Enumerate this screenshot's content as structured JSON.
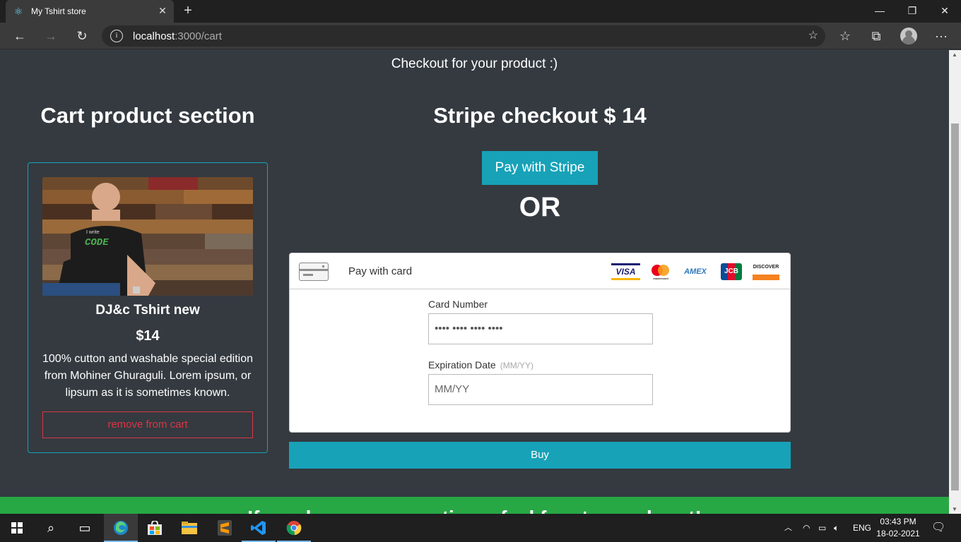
{
  "browser": {
    "tab_title": "My Tshirt store",
    "tab_close": "✕",
    "new_tab": "+",
    "url_host": "localhost",
    "url_path": ":3000/cart",
    "window_controls": {
      "minimize": "—",
      "restore": "❐",
      "close": "✕"
    },
    "nav": {
      "back": "←",
      "forward": "→",
      "reload": "↻"
    },
    "toolbar_icons": {
      "favorite": "☆",
      "favorites": "☆",
      "collections": "⧉",
      "menu": "···"
    }
  },
  "page": {
    "subtitle": "Checkout for your product :)",
    "cart_heading": "Cart product section",
    "product": {
      "name": "DJ&c Tshirt new",
      "price": "$14",
      "description": "100% cutton and washable special edition from Mohiner Ghuraguli. Lorem ipsum, or lipsum as it is sometimes known.",
      "remove_label": "remove from cart",
      "shirt_text_top": "I write",
      "shirt_text_main": "CODE"
    },
    "stripe_heading": "Stripe checkout $ 14",
    "pay_stripe_label": "Pay with Stripe",
    "or_label": "OR",
    "card_form": {
      "header_label": "Pay with card",
      "brands": {
        "visa": "VISA",
        "mastercard": "mastercard",
        "amex": "AMEX",
        "jcb": "JCB",
        "discover": "DISCOVER"
      },
      "card_number_label": "Card Number",
      "card_number_value": "•••• •••• •••• ••••",
      "expiration_label": "Expiration Date",
      "expiration_hint": "(MM/YY)",
      "expiration_placeholder": "MM/YY"
    },
    "buy_label": "Buy",
    "footer_text": "If you have any questions, feel free to reach out!"
  },
  "taskbar": {
    "language": "ENG",
    "time": "03:43 PM",
    "date": "18-02-2021"
  },
  "colors": {
    "page_bg": "#343a40",
    "accent": "#17a2b8",
    "danger": "#dc3545",
    "footer_green": "#28a745"
  }
}
